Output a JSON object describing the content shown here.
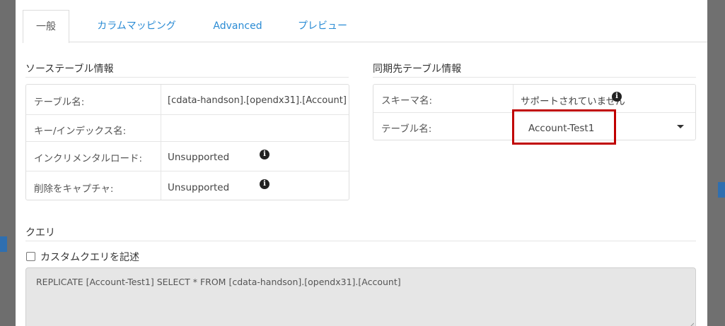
{
  "tabs": [
    {
      "label": "一般",
      "active": true
    },
    {
      "label": "カラムマッピング",
      "active": false
    },
    {
      "label": "Advanced",
      "active": false
    },
    {
      "label": "プレビュー",
      "active": false
    }
  ],
  "source": {
    "title": "ソーステーブル情報",
    "rows": [
      {
        "key": "テーブル名:",
        "value": "[cdata-handson].[opendx31].[Account]"
      },
      {
        "key": "キー/インデックス名:",
        "value": ""
      },
      {
        "key": "インクリメンタルロード:",
        "value": "Unsupported"
      },
      {
        "key": "削除をキャプチャ:",
        "value": "Unsupported"
      }
    ]
  },
  "destination": {
    "title": "同期先テーブル情報",
    "schema_key": "スキーマ名:",
    "schema_value": "サポートされていません",
    "table_key": "テーブル名:",
    "table_value": "Account-Test1"
  },
  "query": {
    "title": "クエリ",
    "custom_label": "カスタムクエリを記述",
    "custom_checked": false,
    "text": "REPLICATE [Account-Test1] SELECT * FROM [cdata-handson].[opendx31].[Account]"
  },
  "colors": {
    "link": "#2a8bd4",
    "highlight": "#c00000",
    "query_bg": "#e6e6e6"
  }
}
